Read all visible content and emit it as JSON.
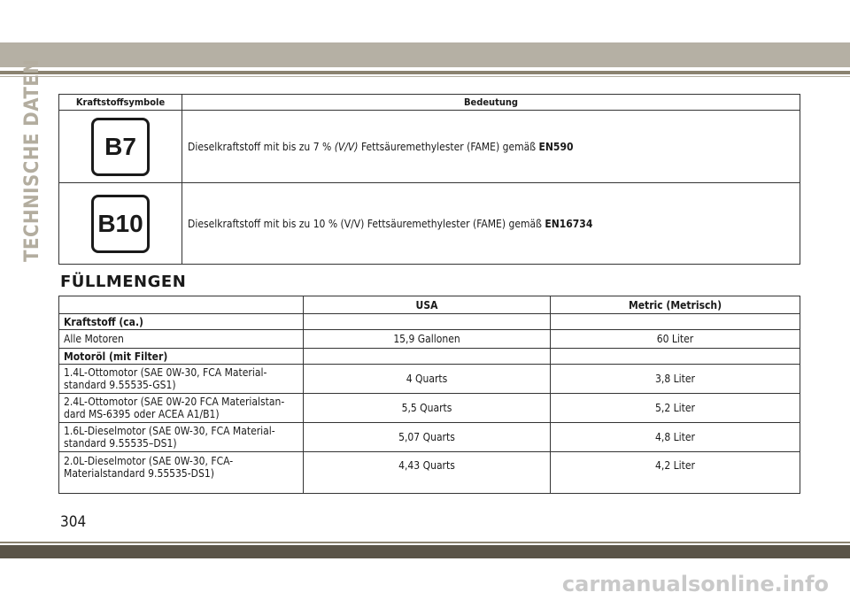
{
  "side_title": "TECHNISCHE DATEN",
  "fuel_table": {
    "headers": [
      "Kraftstoffsymbole",
      "Bedeutung"
    ],
    "rows": [
      {
        "symbol": "B7",
        "text_before": "Dieselkraftstoff mit bis zu 7 %",
        "italic": "(V/V)",
        "text_after": "Fettsäuremethylester (FAME) gemäß",
        "code": "EN590"
      },
      {
        "symbol": "B10",
        "text_before": "Dieselkraftstoff mit bis zu 10 % (V/V) Fettsäuremethylester (FAME) gemäß",
        "code": "EN16734"
      }
    ]
  },
  "section_title": "FÜLLMENGEN",
  "capacity_table": {
    "headers": [
      "",
      "USA",
      "Metric (Metrisch)"
    ],
    "rows": [
      {
        "label": "Kraftstoff (ca.)",
        "usa": "",
        "metric": ""
      },
      {
        "label": "Alle Motoren",
        "usa": "15,9 Gallonen",
        "metric": "60 Liter"
      },
      {
        "label": "Motoröl (mit Filter)",
        "usa": "",
        "metric": ""
      },
      {
        "label_line1": "1.4L-Ottomotor (SAE 0W-30, FCA Material-",
        "label_line2": "standard 9.55535-GS1)",
        "usa": "4 Quarts",
        "metric": "3,8 Liter"
      },
      {
        "label_line1": "2.4L-Ottomotor (SAE 0W-20 FCA Materialstan-",
        "label_line2": "dard MS-6395 oder ACEA A1/B1)",
        "usa": "5,5 Quarts",
        "metric": "5,2 Liter"
      },
      {
        "label_line1": "1.6L-Dieselmotor (SAE 0W-30, FCA Material-",
        "label_line2": "standard 9.55535–DS1)",
        "usa": "5,07 Quarts",
        "metric": "4,8 Liter"
      },
      {
        "label_line1": "2.0L-Dieselmotor (SAE 0W-30, FCA-",
        "label_line2": "Materialstandard 9.55535-DS1)",
        "usa": "4,43 Quarts",
        "metric": "4,2 Liter"
      }
    ]
  },
  "page_number": "304",
  "watermark": "carmanualsonline.info"
}
